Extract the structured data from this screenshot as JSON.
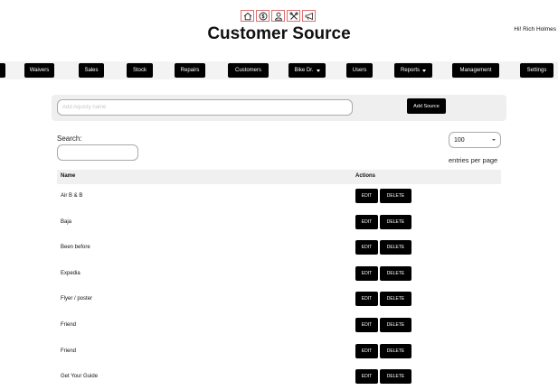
{
  "header": {
    "icons": [
      "home-icon",
      "dollar-icon",
      "user-icon",
      "tools-icon",
      "megaphone-icon"
    ],
    "title": "Customer Source",
    "greeting": "Hi! Rich Holmes"
  },
  "nav": {
    "items": [
      {
        "label": ""
      },
      {
        "label": "Waivers"
      },
      {
        "label": "Sales"
      },
      {
        "label": "Stock"
      },
      {
        "label": "Repairs"
      },
      {
        "label": "Customers"
      },
      {
        "label": "Bike Dr.",
        "dropdown": true
      },
      {
        "label": "Users"
      },
      {
        "label": "Reports",
        "dropdown": true
      },
      {
        "label": "Management"
      },
      {
        "label": "Settings"
      }
    ]
  },
  "add_source": {
    "placeholder": "Add Aquisty name",
    "button_label": "Add Source"
  },
  "table_controls": {
    "search_label": "Search:",
    "per_page_value": "100",
    "per_page_label": "entries per page"
  },
  "table": {
    "columns": [
      "Name",
      "Actions"
    ],
    "edit_label": "EDIT",
    "delete_label": "DELETE",
    "rows": [
      {
        "name": "Air B & B"
      },
      {
        "name": "Baja"
      },
      {
        "name": "Been before"
      },
      {
        "name": "Expedia"
      },
      {
        "name": "Flyer / poster"
      },
      {
        "name": "Friend"
      },
      {
        "name": "Friend"
      },
      {
        "name": "Get Your Guide"
      }
    ]
  }
}
